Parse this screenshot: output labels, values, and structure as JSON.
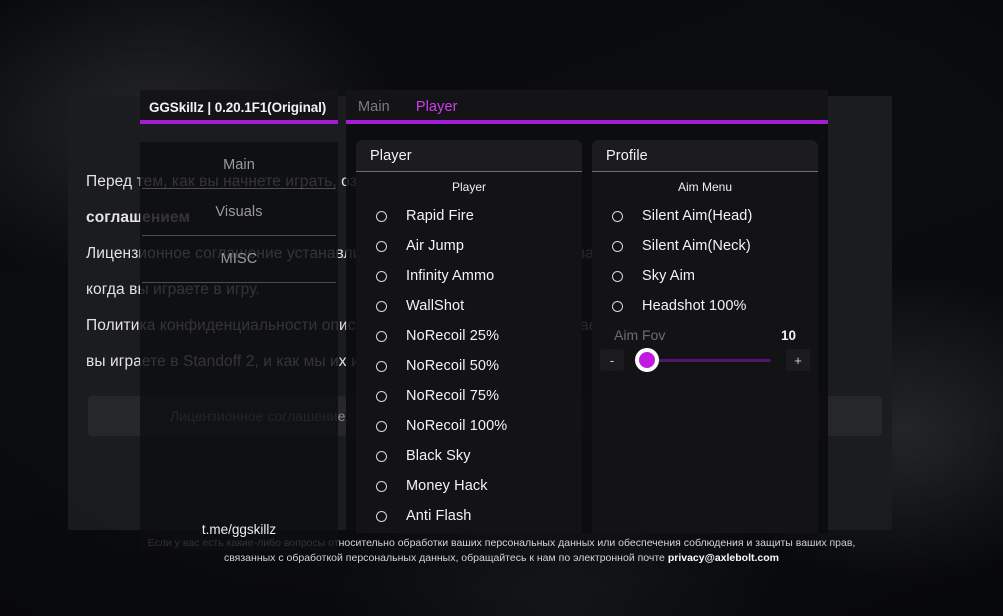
{
  "background": {
    "paragraphs": [
      "Перед тем, как вы начнете играть, ознакомьтесь с Лицензионным",
      "соглашением и Политикой конфиденциальности",
      "Лицензионное соглашение устанавливает правила, применимые к вам,",
      "когда вы играете в игру.",
      "Политика конфиденциальности описывает, какие данные мы собираем, когда",
      "вы играете в Standoff 2, и как мы их используем."
    ],
    "bold_word": "соглашением",
    "button_label": "Лицензионное соглашение",
    "footer_line1": "Если у вас есть какие-либо вопросы относительно обработки ваших персональных данных или обеспечения соблюдения и защиты ваших прав,",
    "footer_line2_prefix": "связанных с обработкой персональных данных, обращайтесь к нам по электронной почте ",
    "footer_email": "privacy@axlebolt.com"
  },
  "menu": {
    "sidebar": {
      "title": "GGSkillz | 0.20.1F1(Original)",
      "items": [
        {
          "label": "Main"
        },
        {
          "label": "Visuals"
        },
        {
          "label": "MISC"
        }
      ],
      "link": "t.me/ggskillz"
    },
    "tabs": [
      {
        "label": "Main",
        "active": false
      },
      {
        "label": "Player",
        "active": true
      }
    ],
    "accent_color": "#a21cd6",
    "panels": [
      {
        "title": "Player",
        "group_label": "Player",
        "options": [
          {
            "label": "Rapid Fire",
            "checked": false
          },
          {
            "label": "Air Jump",
            "checked": false
          },
          {
            "label": "Infinity Ammo",
            "checked": false
          },
          {
            "label": "WallShot",
            "checked": false
          },
          {
            "label": "NoRecoil 25%",
            "checked": false
          },
          {
            "label": "NoRecoil 50%",
            "checked": false
          },
          {
            "label": "NoRecoil 75%",
            "checked": false
          },
          {
            "label": "NoRecoil 100%",
            "checked": false
          },
          {
            "label": "Black Sky",
            "checked": false
          },
          {
            "label": "Money Hack",
            "checked": false
          },
          {
            "label": "Anti Flash",
            "checked": false
          }
        ]
      },
      {
        "title": "Profile",
        "group_label": "Aim Menu",
        "options": [
          {
            "label": "Silent Aim(Head)",
            "checked": false
          },
          {
            "label": "Silent Aim(Neck)",
            "checked": false
          },
          {
            "label": "Sky Aim",
            "checked": false
          },
          {
            "label": "Headshot 100%",
            "checked": false
          }
        ],
        "slider": {
          "name": "Aim Fov",
          "value": "10",
          "decrement_label": "-",
          "increment_label": "+",
          "fill_percent": 4
        }
      }
    ]
  }
}
